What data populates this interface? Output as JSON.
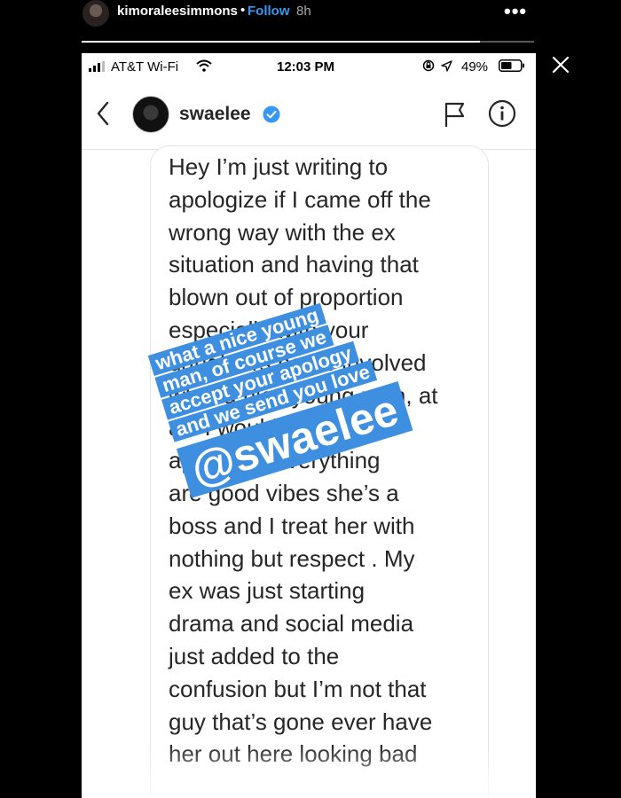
{
  "story": {
    "username": "kimoraleesimmons",
    "separator": "•",
    "follow_label": "Follow",
    "time_ago": "8h",
    "more_label": "•••",
    "progress": 0.88
  },
  "status_bar": {
    "carrier": "AT&T Wi-Fi",
    "time": "12:03 PM",
    "battery_percent": "49%"
  },
  "dm": {
    "username": "swaelee",
    "message_lines": [
      "Hey I’m just writing to",
      "apologize if I came off the",
      "wrong way with the ex",
      "situation and having that",
      "blown out of proportion",
      "especially with your",
      "daughters name involved",
      "what a nice young man, at",
      "all. I would like to",
      "apologize everything",
      "are good vibes she’s a",
      "boss and I treat her with",
      "nothing but respect . My",
      "ex was just starting",
      "drama and social media",
      "just added to the",
      "confusion but I’m not that",
      "guy that’s gone ever have",
      "her out here looking bad"
    ]
  },
  "caption": {
    "lines": [
      "what a nice young",
      "man, of course we",
      "accept your apology",
      "and we send you love"
    ],
    "mention": "@swaelee"
  },
  "colors": {
    "accent": "#3897f0",
    "caption_bg": "#3e8fe0",
    "background": "#000000"
  },
  "icons": [
    "close-icon",
    "signal-icon",
    "wifi-icon",
    "rotation-lock-icon",
    "location-arrow-icon",
    "battery-icon",
    "back-chevron-icon",
    "verified-badge-icon",
    "flag-icon",
    "info-icon"
  ]
}
